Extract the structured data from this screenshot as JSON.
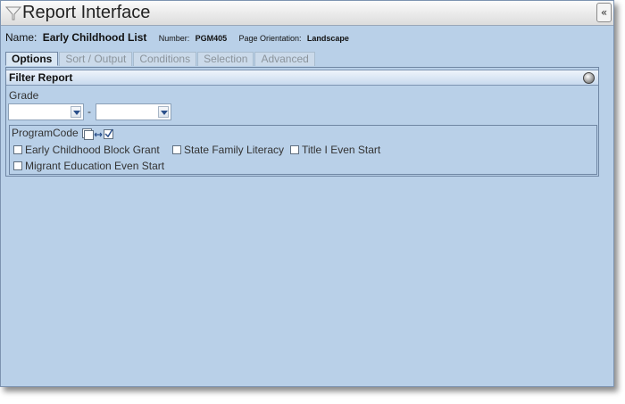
{
  "window": {
    "title": "Report Interface",
    "collapse_glyph": "«"
  },
  "report": {
    "name_label": "Name:",
    "name": "Early Childhood List",
    "number_label": "Number:",
    "number": "PGM405",
    "orientation_label": "Page Orientation:",
    "orientation": "Landscape"
  },
  "tabs": [
    {
      "label": "Options",
      "active": true
    },
    {
      "label": "Sort / Output",
      "active": false
    },
    {
      "label": "Conditions",
      "active": false
    },
    {
      "label": "Selection",
      "active": false
    },
    {
      "label": "Advanced",
      "active": false
    }
  ],
  "filter": {
    "title": "Filter Report",
    "grade": {
      "label": "Grade",
      "from_value": "",
      "separator": "-",
      "to_value": ""
    },
    "program_code": {
      "label": "ProgramCode",
      "options": [
        {
          "label": "Early Childhood Block Grant",
          "checked": false
        },
        {
          "label": "State Family Literacy",
          "checked": false
        },
        {
          "label": "Title I Even Start",
          "checked": false
        },
        {
          "label": "Migrant Education Even Start",
          "checked": false
        }
      ]
    }
  },
  "colors": {
    "background": "#b9d0e8",
    "border": "#6f86a3"
  },
  "icons": {
    "title": "filter-funnel-icon",
    "collapse": "double-chevron-left-icon",
    "panel": "round-knob-icon",
    "program_toggle": "select-toggle-icon"
  }
}
